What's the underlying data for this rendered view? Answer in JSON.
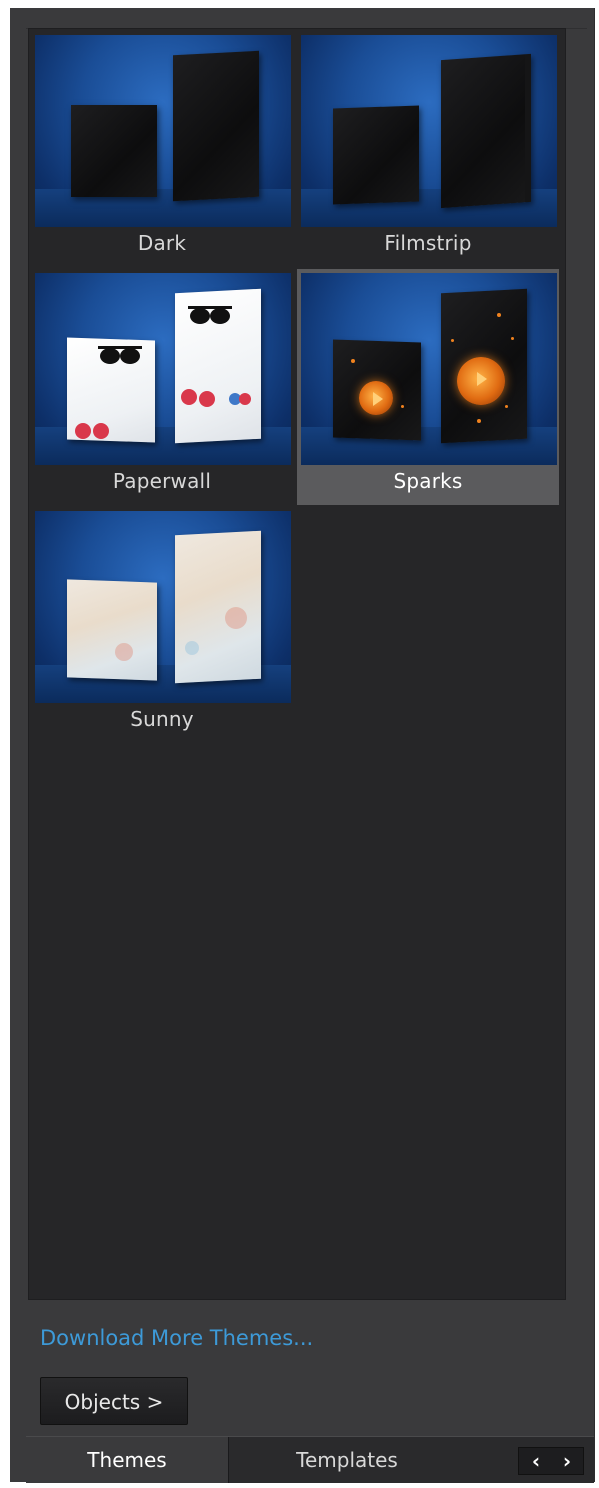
{
  "themes": [
    {
      "name": "Dark",
      "style": "dark",
      "selected": false
    },
    {
      "name": "Filmstrip",
      "style": "filmstrip",
      "selected": false
    },
    {
      "name": "Paperwall",
      "style": "paperwall",
      "selected": false
    },
    {
      "name": "Sparks",
      "style": "sparks",
      "selected": true
    },
    {
      "name": "Sunny",
      "style": "sunny",
      "selected": false
    }
  ],
  "download_link": "Download More Themes...",
  "objects_button": "Objects >",
  "tabs": [
    {
      "label": "Themes",
      "active": true
    },
    {
      "label": "Templates",
      "active": false
    }
  ],
  "nav": {
    "prev_icon": "chevron-left-icon",
    "next_icon": "chevron-right-icon",
    "prev": "‹",
    "next": "›"
  },
  "colors": {
    "panel_bg": "#3a3a3c",
    "gallery_bg": "#262628",
    "selected_tile_bg": "#5b5b5d",
    "link": "#3d9ad8",
    "thumb_blue": "#1a4d96"
  }
}
